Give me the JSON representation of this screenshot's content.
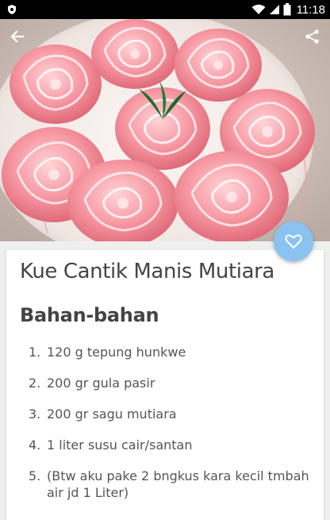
{
  "status_bar": {
    "time": "11:18"
  },
  "recipe": {
    "title": "Kue Cantik Manis Mutiara",
    "section_heading": "Bahan-bahan",
    "ingredients": [
      {
        "num": "1.",
        "text": "120 g tepung hunkwe"
      },
      {
        "num": "2.",
        "text": "200 gr gula pasir"
      },
      {
        "num": "3.",
        "text": "200 gr sagu mutiara"
      },
      {
        "num": "4.",
        "text": "1 liter susu cair/santan"
      },
      {
        "num": "5.",
        "text": "(Btw aku pake 2 bngkus kara kecil tmbah air jd 1 Liter)"
      }
    ]
  },
  "icons": {
    "back": "arrow-back-icon",
    "share": "share-icon",
    "favorite": "heart-outline-icon"
  },
  "colors": {
    "fab": "#8ac3ef",
    "status_bar": "#000000"
  }
}
